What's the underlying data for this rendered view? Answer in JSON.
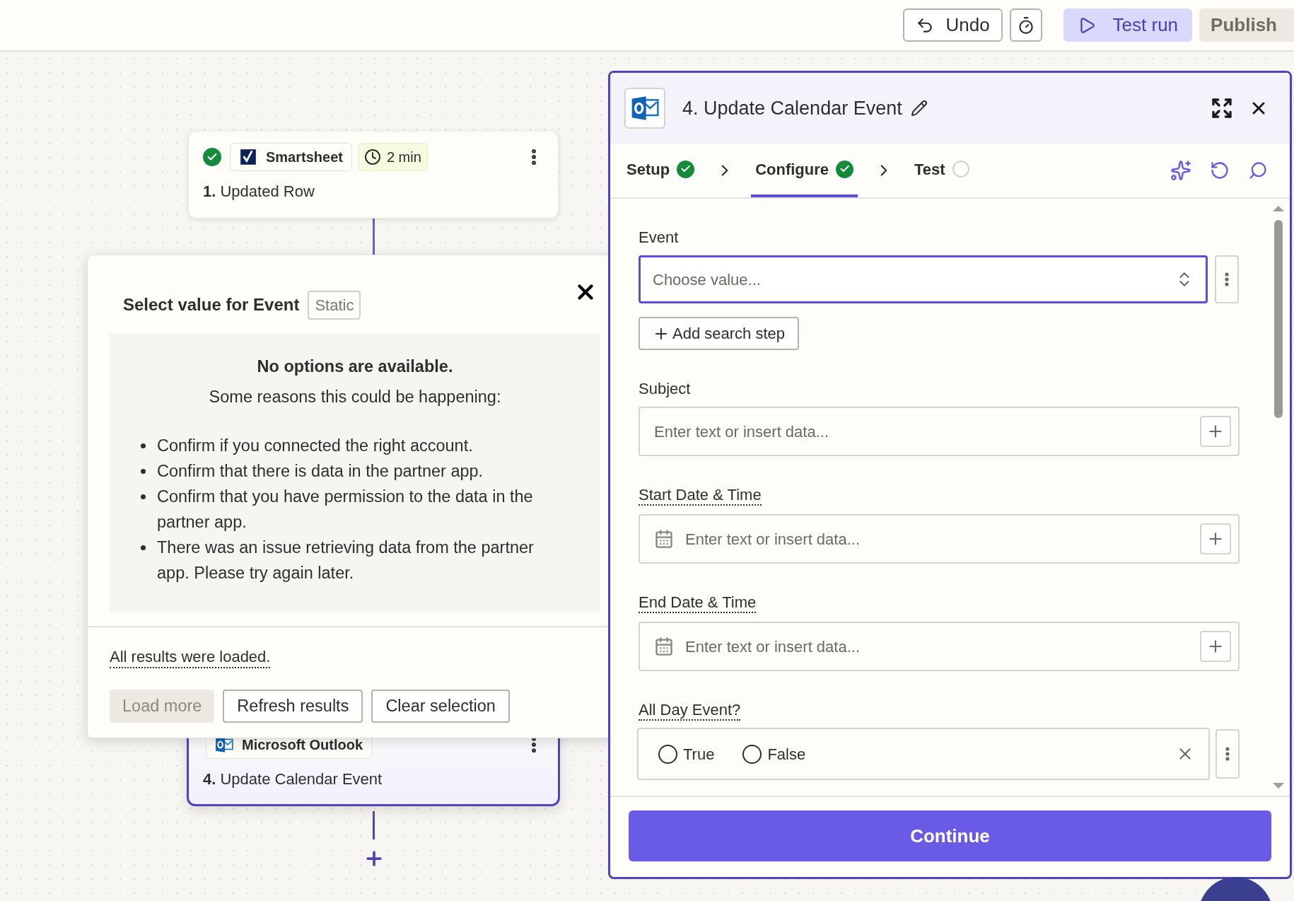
{
  "toolbar": {
    "buttons": [
      {
        "kind": "undo",
        "label": "Undo"
      },
      {
        "kind": "history"
      },
      {
        "kind": "test",
        "label": "Test run"
      },
      {
        "kind": "publish",
        "label": "Publish"
      }
    ]
  },
  "canvas": {
    "nodes": [
      {
        "success": true,
        "app": "Smartsheet",
        "kind": "smartsheet",
        "duration": "2 min",
        "number": "1.",
        "title": "Updated Row",
        "selected": false
      },
      {
        "success": false,
        "app": "Microsoft Outlook",
        "kind": "outlook",
        "number": "4.",
        "title": "Update Calendar Event",
        "selected": true
      }
    ]
  },
  "popover": {
    "title": "Select value for Event",
    "badge": "Static",
    "heading": "No options are available.",
    "subheading": "Some reasons this could be happening:",
    "reasons": [
      "Confirm if you connected the right account.",
      "Confirm that there is data in the partner app.",
      "Confirm that you have permission to the data in the partner app.",
      "There was an issue retrieving data from the partner app. Please try again later."
    ],
    "note": "All results were loaded.",
    "buttons": [
      {
        "label": "Load more",
        "disabled": true
      },
      {
        "label": "Refresh results",
        "disabled": false
      },
      {
        "label": "Clear selection",
        "disabled": false
      }
    ]
  },
  "panel": {
    "title": "4. Update Calendar Event",
    "steps": [
      {
        "label": "Setup",
        "completed": true,
        "selected": false
      },
      {
        "label": "Configure",
        "completed": true,
        "selected": true
      },
      {
        "label": "Test",
        "completed": false,
        "selected": false
      }
    ],
    "fields": [
      {
        "kind": "select",
        "label": "Event",
        "help": false,
        "placeholder": "Choose value...",
        "focused": true,
        "action": "Add search step"
      },
      {
        "kind": "text",
        "label": "Subject",
        "help": false,
        "placeholder": "Enter text or insert data..."
      },
      {
        "kind": "datetime",
        "label": "Start Date & Time",
        "help": true,
        "placeholder": "Enter text or insert data..."
      },
      {
        "kind": "datetime",
        "label": "End Date & Time",
        "help": true,
        "placeholder": "Enter text or insert data..."
      },
      {
        "kind": "radio",
        "label": "All Day Event?",
        "help": true,
        "options": [
          {
            "label": "True",
            "selected": false
          },
          {
            "label": "False",
            "selected": false
          }
        ]
      }
    ],
    "primary": "Continue"
  }
}
